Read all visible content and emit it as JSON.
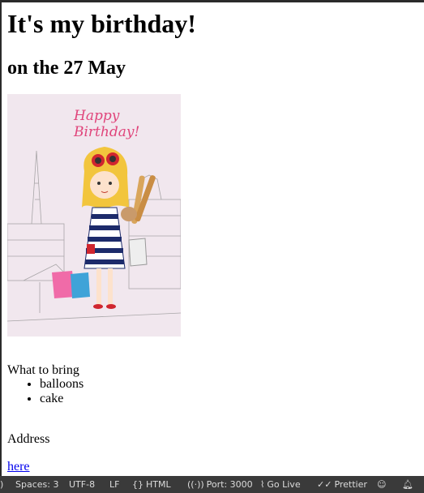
{
  "page": {
    "title": "It's my birthday!",
    "subtitle": "on the 27 May",
    "card": {
      "line1": "Happy",
      "line2": "Birthday!"
    },
    "bring_label": "What to bring",
    "items": [
      "balloons",
      "cake"
    ],
    "address_label": "Address",
    "link_text": "here"
  },
  "statusbar": {
    "left_fragment": ")",
    "spaces": "Spaces: 3",
    "encoding": "UTF-8",
    "eol": "LF",
    "language": "HTML",
    "port": "Port: 3000",
    "go_live": "Go Live",
    "prettier": "Prettier"
  },
  "colors": {
    "statusbar_bg": "#3a3a3a",
    "link": "#0000ee",
    "card_bg": "#f1e7ee",
    "card_text": "#e0457b"
  }
}
